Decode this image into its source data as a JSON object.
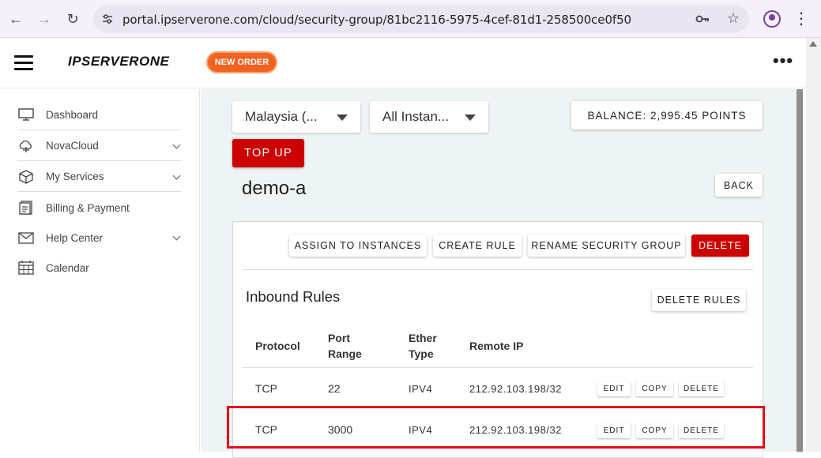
{
  "browser": {
    "url": "portal.ipserverone.com/cloud/security-group/81bc2116-5975-4cef-81d1-258500ce0f50"
  },
  "header": {
    "logo_text": "IPSERVERONE",
    "new_order_label": "NEW ORDER",
    "more_label": "•••"
  },
  "sidebar": {
    "items": [
      {
        "label": "Dashboard",
        "icon": "monitor-icon",
        "expandable": false
      },
      {
        "label": "NovaCloud",
        "icon": "cloud-icon",
        "expandable": true
      },
      {
        "label": "My Services",
        "icon": "box-icon",
        "expandable": true
      },
      {
        "label": "Billing & Payment",
        "icon": "receipt-icon",
        "expandable": false
      },
      {
        "label": "Help Center",
        "icon": "mail-icon",
        "expandable": true
      },
      {
        "label": "Calendar",
        "icon": "calendar-icon",
        "expandable": false
      }
    ]
  },
  "filters": {
    "region": "Malaysia (...",
    "instances": "All Instan..."
  },
  "balance_label": "BALANCE: 2,995.45 POINTS",
  "topup_label": "TOP UP",
  "page_title": "demo-a",
  "back_label": "BACK",
  "actions": {
    "assign": "ASSIGN TO INSTANCES",
    "create_rule": "CREATE RULE",
    "rename": "RENAME SECURITY GROUP",
    "delete": "DELETE"
  },
  "inbound": {
    "title": "Inbound Rules",
    "delete_rules_label": "DELETE RULES",
    "columns": {
      "protocol": "Protocol",
      "port_line1": "Port",
      "port_line2": "Range",
      "ether_line1": "Ether",
      "ether_line2": "Type",
      "remote_ip": "Remote IP"
    },
    "rows": [
      {
        "protocol": "TCP",
        "port": "22",
        "ether": "IPV4",
        "remote_ip": "212.92.103.198/32",
        "edit": "EDIT",
        "copy": "COPY",
        "delete": "DELETE"
      },
      {
        "protocol": "TCP",
        "port": "3000",
        "ether": "IPV4",
        "remote_ip": "212.92.103.198/32",
        "edit": "EDIT",
        "copy": "COPY",
        "delete": "DELETE"
      }
    ]
  },
  "colors": {
    "accent_red": "#cc0000",
    "new_order_orange": "#f26322",
    "highlight_red": "#e0101a",
    "main_bg": "#eef3f4"
  }
}
